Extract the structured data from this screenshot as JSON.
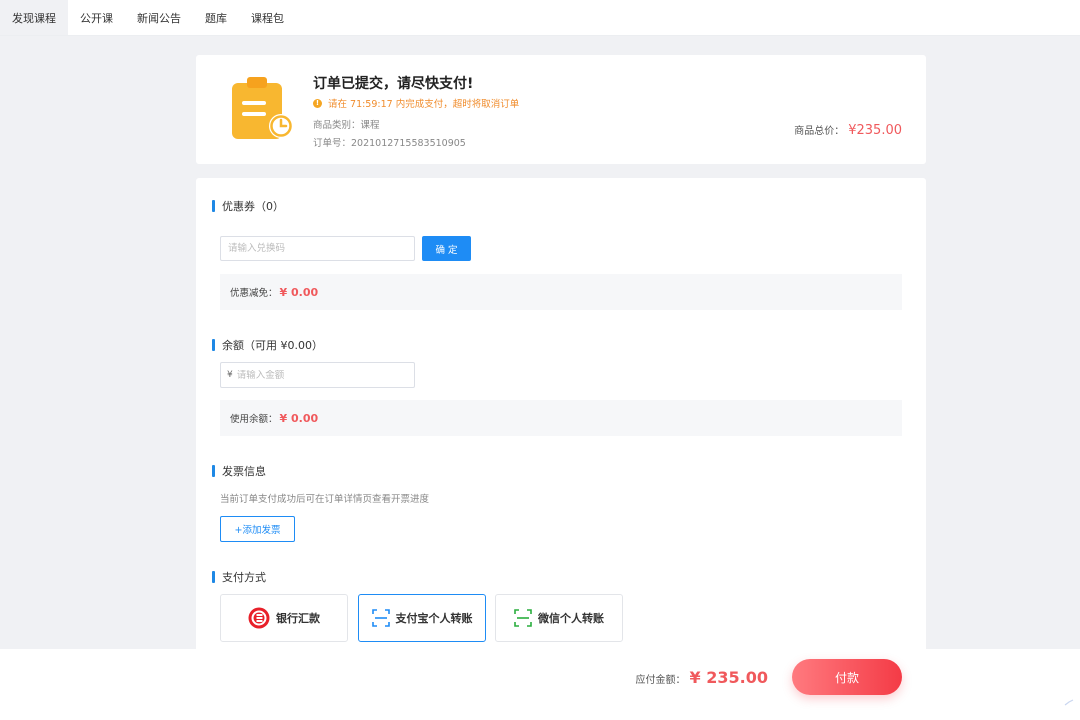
{
  "nav": {
    "items": [
      "发现课程",
      "公开课",
      "新闻公告",
      "题库",
      "课程包"
    ],
    "active_index": 0
  },
  "order": {
    "title": "订单已提交，请尽快支付!",
    "warning": "请在 71:59:17 内完成支付，超时将取消订单",
    "category": "商品类别：课程",
    "order_no": "订单号：2021012715583510905",
    "total_label": "商品总价：",
    "total_value": "¥235.00"
  },
  "coupon": {
    "title": "优惠券（0）",
    "placeholder": "请输入兑换码",
    "confirm_label": "确 定",
    "discount_label": "优惠减免：",
    "discount_value": "¥ 0.00"
  },
  "balance": {
    "title": "余额（可用 ¥0.00）",
    "currency": "¥",
    "placeholder": "请输入金额",
    "used_label": "使用余额：",
    "used_value": "¥ 0.00"
  },
  "invoice": {
    "title": "发票信息",
    "note": "当前订单支付成功后可在订单详情页查看开票进度",
    "add_label": "+添加发票"
  },
  "payment": {
    "title": "支付方式",
    "options": [
      "银行汇款",
      "支付宝个人转账",
      "微信个人转账"
    ],
    "selected_index": 1
  },
  "footer": {
    "due_label": "应付金额：",
    "due_value": "¥ 235.00",
    "pay_label": "付款"
  },
  "colors": {
    "accent": "#1e8cf5",
    "price": "#f0595c",
    "warning": "#f08c2c"
  }
}
